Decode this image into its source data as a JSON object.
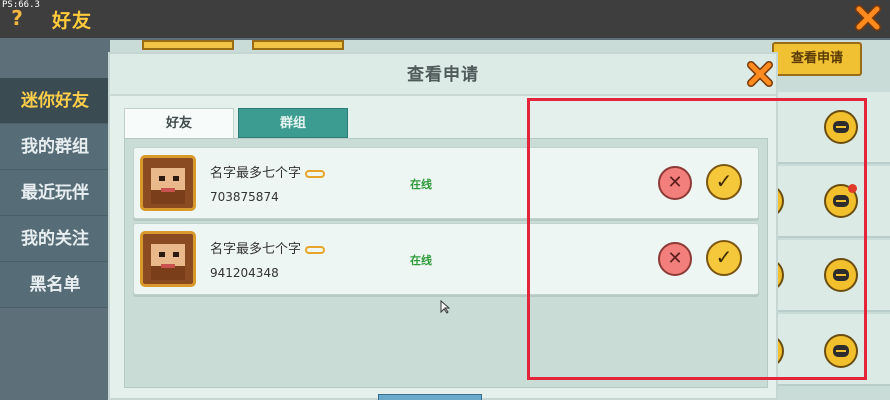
{
  "fps": "PS:66.3",
  "header": {
    "title": "好友",
    "help_label": "?"
  },
  "sidebar": {
    "items": [
      {
        "label": "迷你好友",
        "active": true
      },
      {
        "label": "我的群组",
        "active": false
      },
      {
        "label": "最近玩伴",
        "active": false
      },
      {
        "label": "我的关注",
        "active": false
      },
      {
        "label": "黑名单",
        "active": false
      }
    ]
  },
  "request_button": "查看申请",
  "modal": {
    "title": "查看申请",
    "tabs": [
      {
        "label": "好友",
        "active": true
      },
      {
        "label": "群组",
        "active": false
      }
    ],
    "requests": [
      {
        "name": "名字最多七个字",
        "uid": "703875874",
        "status": "在线"
      },
      {
        "name": "名字最多七个字",
        "uid": "941204348",
        "status": "在线"
      }
    ],
    "reject_symbol": "✕",
    "accept_symbol": "✓"
  },
  "colors": {
    "accent_yellow": "#f4c83a",
    "reject_red": "#f27f7b",
    "online_green": "#2f9a3a",
    "highlight_red": "#e3243a",
    "tab_teal": "#3d9c91"
  }
}
